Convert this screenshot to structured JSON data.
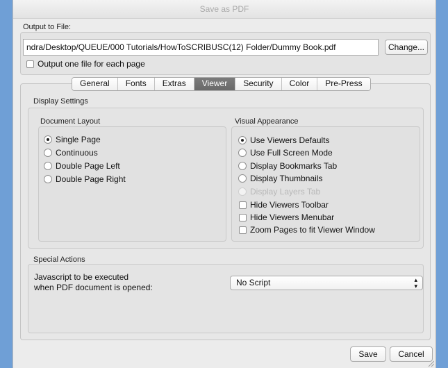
{
  "window": {
    "title": "Save as PDF"
  },
  "output": {
    "label": "Output to File:",
    "path": "ndra/Desktop/QUEUE/000 Tutorials/HowToSCRIBUSC(12) Folder/Dummy Book.pdf",
    "change_label": "Change...",
    "one_file_label": "Output one file for each page"
  },
  "tabs": [
    "General",
    "Fonts",
    "Extras",
    "Viewer",
    "Security",
    "Color",
    "Pre-Press"
  ],
  "active_tab": "Viewer",
  "display_settings": {
    "label": "Display Settings",
    "document_layout": {
      "label": "Document Layout",
      "options": [
        "Single Page",
        "Continuous",
        "Double Page Left",
        "Double Page Right"
      ],
      "selected": "Single Page"
    },
    "visual_appearance": {
      "label": "Visual Appearance",
      "radios": [
        "Use Viewers Defaults",
        "Use Full Screen Mode",
        "Display Bookmarks Tab",
        "Display Thumbnails",
        "Display Layers Tab"
      ],
      "selected": "Use Viewers Defaults",
      "disabled": "Display Layers Tab",
      "checks": [
        "Hide Viewers Toolbar",
        "Hide Viewers Menubar",
        "Zoom Pages to fit Viewer Window"
      ]
    }
  },
  "special_actions": {
    "label": "Special Actions",
    "js_label_line1": "Javascript to be executed",
    "js_label_line2": "when PDF document is opened:",
    "script_value": "No Script"
  },
  "buttons": {
    "save": "Save",
    "cancel": "Cancel"
  }
}
